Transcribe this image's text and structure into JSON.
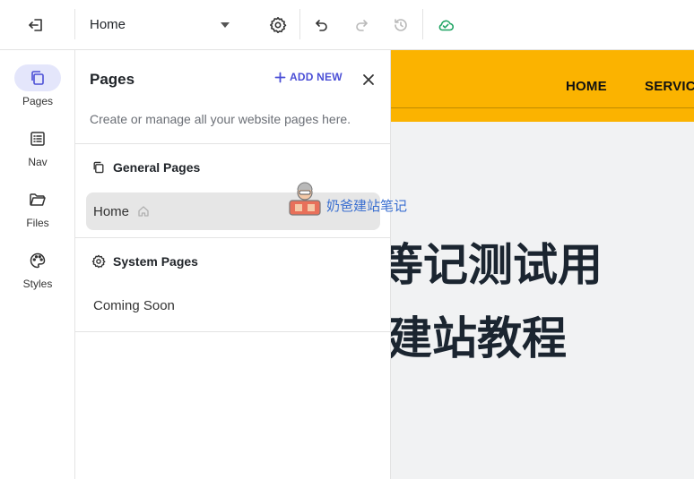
{
  "toolbar": {
    "page_select_value": "Home",
    "icons": [
      "exit-icon",
      "caret-down-icon",
      "gear-icon",
      "undo-icon",
      "redo-icon",
      "history-icon",
      "cloud-check-icon"
    ]
  },
  "rail": {
    "items": [
      {
        "label": "Pages",
        "icon": "pages-icon",
        "active": true
      },
      {
        "label": "Nav",
        "icon": "nav-list-icon",
        "active": false
      },
      {
        "label": "Files",
        "icon": "folder-icon",
        "active": false
      },
      {
        "label": "Styles",
        "icon": "palette-icon",
        "active": false
      }
    ]
  },
  "panel": {
    "title": "Pages",
    "add_new_label": "ADD NEW",
    "description": "Create or manage all your website pages here.",
    "general_section": {
      "label": "General Pages",
      "pages": [
        {
          "label": "Home",
          "selected": true
        }
      ]
    },
    "system_section": {
      "label": "System Pages",
      "pages": [
        {
          "label": "Coming Soon",
          "selected": false
        }
      ]
    }
  },
  "preview": {
    "nav_home": "HOME",
    "nav_service": "SERVICE",
    "hero_line1": "等记测试用",
    "hero_line2": "建站教程"
  },
  "watermark": {
    "text": "奶爸建站笔记"
  },
  "colors": {
    "accent": "#4b4fd6",
    "active_rail_bg": "#e4e6fb",
    "header_yellow": "#fbb300",
    "cloud_green": "#1fa463",
    "hero_text": "#1b2530"
  }
}
